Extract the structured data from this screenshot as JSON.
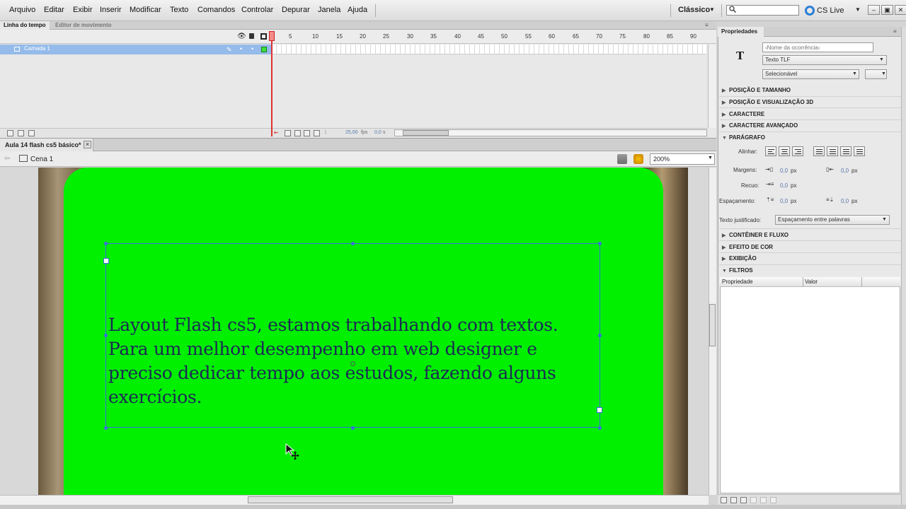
{
  "menu": {
    "items": [
      "Arquivo",
      "Editar",
      "Exibir",
      "Inserir",
      "Modificar",
      "Texto",
      "Comandos",
      "Controlar",
      "Depurar",
      "Janela",
      "Ajuda"
    ],
    "workspace": "Clássico",
    "cs_live": "CS Live",
    "search_value": ""
  },
  "timeline": {
    "tabs": [
      "Linha do tempo",
      "Editor de movimento"
    ],
    "frame_numbers": [
      "1",
      "5",
      "10",
      "15",
      "20",
      "25",
      "30",
      "35",
      "40",
      "45",
      "50",
      "55",
      "60",
      "65",
      "70",
      "75",
      "80",
      "85",
      "90"
    ],
    "layer_name": "Camada 1",
    "current_frame": "1",
    "fps": "25,00",
    "fps_unit": "fps",
    "time": "0,0",
    "time_unit": "s"
  },
  "document": {
    "tab_title": "Aula 14 flash cs5 básico*",
    "close_glyph": "×",
    "scene": "Cena 1",
    "zoom": "200%"
  },
  "stage": {
    "text": "Layout Flash cs5, estamos trabalhando com textos. Para um melhor desempenho em web designer e preciso dedicar tempo aos estudos, fazendo alguns exercícios.",
    "colors": {
      "background_green": "#00f000",
      "text": "#1d2a55",
      "selection": "#3c6ee0"
    }
  },
  "properties": {
    "tab": "Propriedades",
    "tool_icon": "T",
    "instance_name_placeholder": "‹Nome da ocorrência›",
    "text_type": "Texto TLF",
    "behavior": "Selecionável",
    "sections_collapsed_top": [
      "POSIÇÃO E TAMANHO",
      "POSIÇÃO E VISUALIZAÇÃO 3D",
      "CARACTERE",
      "CARACTERE AVANÇADO"
    ],
    "paragraph_section": "PARÁGRAFO",
    "align_label": "Alinhar:",
    "margins_label": "Margens:",
    "indent_label": "Recuo:",
    "spacing_label": "Espaçamento:",
    "margin_left": "0,0",
    "margin_right": "0,0",
    "indent": "0,0",
    "space_before": "0,0",
    "space_after": "0,0",
    "unit": "px",
    "justify_label": "Texto justificado:",
    "justify_value": "Espaçamento entre palavras",
    "sections_collapsed_bottom": [
      "CONTÊINER E FLUXO",
      "EFEITO DE COR",
      "EXIBIÇÃO"
    ],
    "filters_section": "FILTROS",
    "filter_columns": [
      "Propriedade",
      "Valor"
    ]
  }
}
